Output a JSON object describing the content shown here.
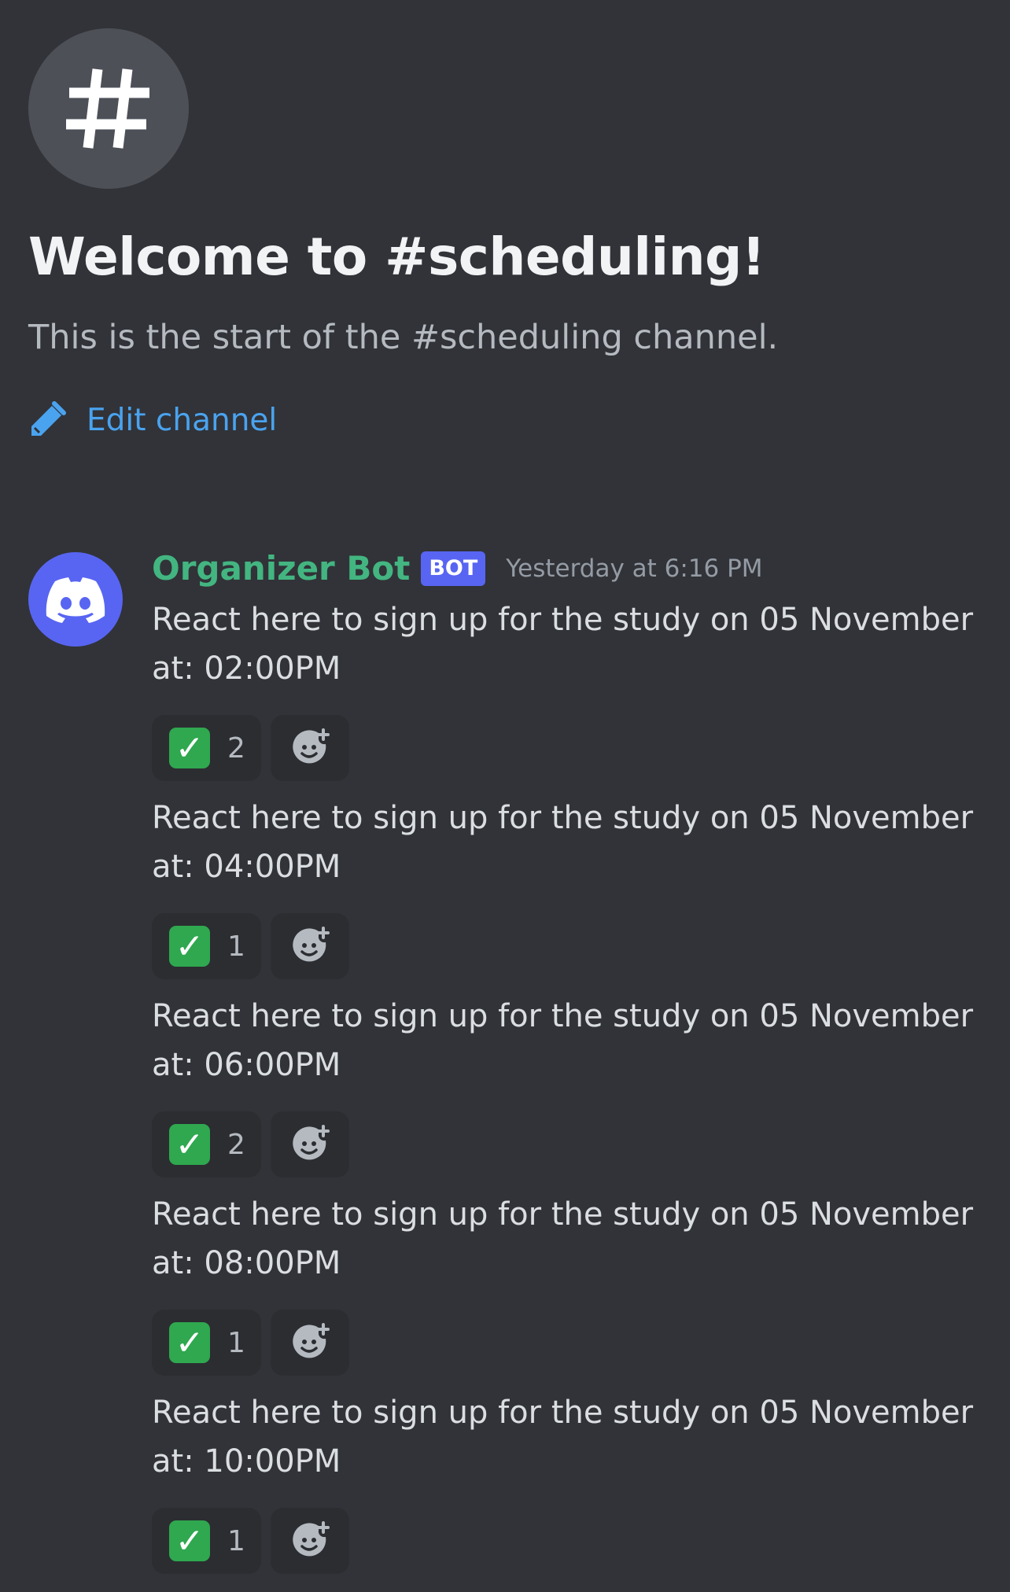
{
  "channel": {
    "icon": "hash-icon",
    "welcome_title": "Welcome to #scheduling!",
    "welcome_subtitle": "This is the start of the #scheduling channel.",
    "edit_label": "Edit channel"
  },
  "message_group": {
    "author": "Organizer Bot",
    "author_color": "#43b581",
    "bot_tag": "BOT",
    "timestamp": "Yesterday at 6:16 PM",
    "messages": [
      {
        "line1": "React here to sign up for the study on 05 November",
        "line2": "at: 02:00PM",
        "reaction_emoji": "✓",
        "reaction_count": "2"
      },
      {
        "line1": "React here to sign up for the study on 05 November",
        "line2": "at: 04:00PM",
        "reaction_emoji": "✓",
        "reaction_count": "1"
      },
      {
        "line1": "React here to sign up for the study on 05 November",
        "line2": "at: 06:00PM",
        "reaction_emoji": "✓",
        "reaction_count": "2"
      },
      {
        "line1": "React here to sign up for the study on 05 November",
        "line2": "at: 08:00PM",
        "reaction_emoji": "✓",
        "reaction_count": "1"
      },
      {
        "line1": "React here to sign up for the study on 05 November",
        "line2": "at: 10:00PM",
        "reaction_emoji": "✓",
        "reaction_count": "1"
      }
    ]
  },
  "colors": {
    "background": "#313338",
    "accent": "#5865f2",
    "link": "#4aa3ef",
    "check_green": "#2fa84f"
  }
}
